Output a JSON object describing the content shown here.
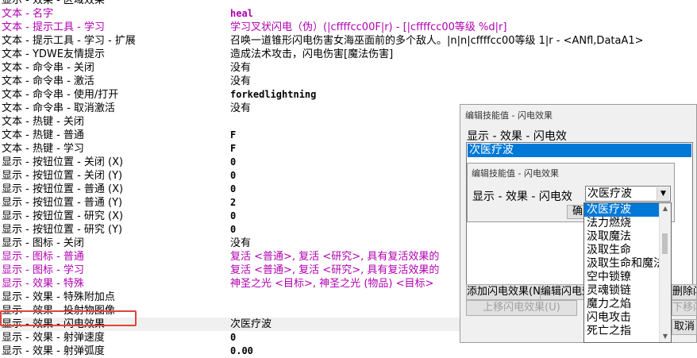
{
  "rows": [
    {
      "k": "显示 - 效果 - 区域效果",
      "v": "",
      "purple": false
    },
    {
      "k": "文本 - 名字",
      "v": "heal",
      "purple": true,
      "bold": true
    },
    {
      "k": "文本 - 提示工具 - 学习",
      "v": "学习叉状闪电（伪）(|cffffcc00F|r) - [|cffffcc00等级 %d|r]",
      "purple": true
    },
    {
      "k": "文本 - 提示工具 - 学习 - 扩展",
      "v": "召唤一道锥形闪电伤害女海巫面前的多个敌人。|n|n|cffffcc00等级 1|r - <ANfl,DataA1>",
      "purple": false,
      "dark": true
    },
    {
      "k": "文本 - YDWE友情提示",
      "v": "造成法术攻击，闪电伤害[魔法伤害]",
      "purple": false
    },
    {
      "k": "文本 - 命令串 - 关闭",
      "v": "没有",
      "purple": false
    },
    {
      "k": "文本 - 命令串 - 激活",
      "v": "没有",
      "purple": false
    },
    {
      "k": "文本 - 命令串 - 使用/打开",
      "v": "forkedlightning",
      "purple": false,
      "bold": true
    },
    {
      "k": "文本 - 命令串 - 取消激活",
      "v": "没有",
      "purple": false
    },
    {
      "k": "文本 - 热键 - 关闭",
      "v": "",
      "purple": false
    },
    {
      "k": "文本 - 热键 - 普通",
      "v": "F",
      "purple": false,
      "bold": true
    },
    {
      "k": "文本 - 热键 - 学习",
      "v": "F",
      "purple": false,
      "bold": true
    },
    {
      "k": "显示 - 按钮位置 - 关闭 (X)",
      "v": "0",
      "purple": false,
      "bold": true
    },
    {
      "k": "显示 - 按钮位置 - 关闭 (Y)",
      "v": "0",
      "purple": false,
      "bold": true
    },
    {
      "k": "显示 - 按钮位置 - 普通 (X)",
      "v": "0",
      "purple": false,
      "bold": true
    },
    {
      "k": "显示 - 按钮位置 - 普通 (Y)",
      "v": "2",
      "purple": false,
      "bold": true
    },
    {
      "k": "显示 - 按钮位置 - 研究 (X)",
      "v": "0",
      "purple": false,
      "bold": true
    },
    {
      "k": "显示 - 按钮位置 - 研究 (Y)",
      "v": "0",
      "purple": false,
      "bold": true
    },
    {
      "k": "显示 - 图标 - 关闭",
      "v": "没有",
      "purple": false
    },
    {
      "k": "显示 - 图标 - 普通",
      "v": "复活 <普通>, 复活 <研究>, 具有复活效果的",
      "purple": true
    },
    {
      "k": "显示 - 图标 - 学习",
      "v": "复活 <普通>, 复活 <研究>, 具有复活效果的",
      "purple": true
    },
    {
      "k": "显示 - 效果 - 特殊",
      "v": "神圣之光 <目标>, 神圣之光 (物品) <目标>",
      "purple": true
    },
    {
      "k": "显示 - 效果 - 特殊附加点",
      "v": "",
      "purple": false
    },
    {
      "k": "显示 - 效果 - 投射物图像",
      "v": "",
      "purple": false
    },
    {
      "k": "显示 - 效果 - 闪电效果",
      "v": "次医疗波",
      "purple": false,
      "sel": true
    },
    {
      "k": "显示 - 效果 - 射弹速度",
      "v": "0",
      "purple": false,
      "bold": true
    },
    {
      "k": "显示 - 效果 - 射弹弧度",
      "v": "0.00",
      "purple": false,
      "bold": true
    }
  ],
  "outer_dialog": {
    "title": "编辑技能值 - 闪电效果",
    "label": "显示 - 效果 - 闪电效",
    "selected_item": "次医疗波",
    "add_button": "添加闪电效果(N)",
    "edit_button": "编辑闪电效果(E)",
    "delete_button": "删除闪电效果(R)",
    "move_up_button": "上移闪电效果(U)",
    "move_down_button": "下移闪电效果(D)",
    "cancel_button": "取消"
  },
  "inner_dialog": {
    "title": "编辑技能值 - 闪电效果",
    "label": "显示 - 效果 - 闪电效",
    "combo_value": "次医疗波",
    "ok_button": "确定"
  },
  "dropdown": {
    "options": [
      "次医疗波",
      "法力燃烧",
      "汲取魔法",
      "汲取生命",
      "汲取生命和魔法",
      "空中锁镣",
      "灵魂锁链",
      "魔力之焰",
      "闪电攻击",
      "死亡之指"
    ],
    "selected_index": 0
  },
  "colors": {
    "purple": "#b000b0",
    "selection": "#0078d7",
    "highlight_box": "#e0443c"
  }
}
